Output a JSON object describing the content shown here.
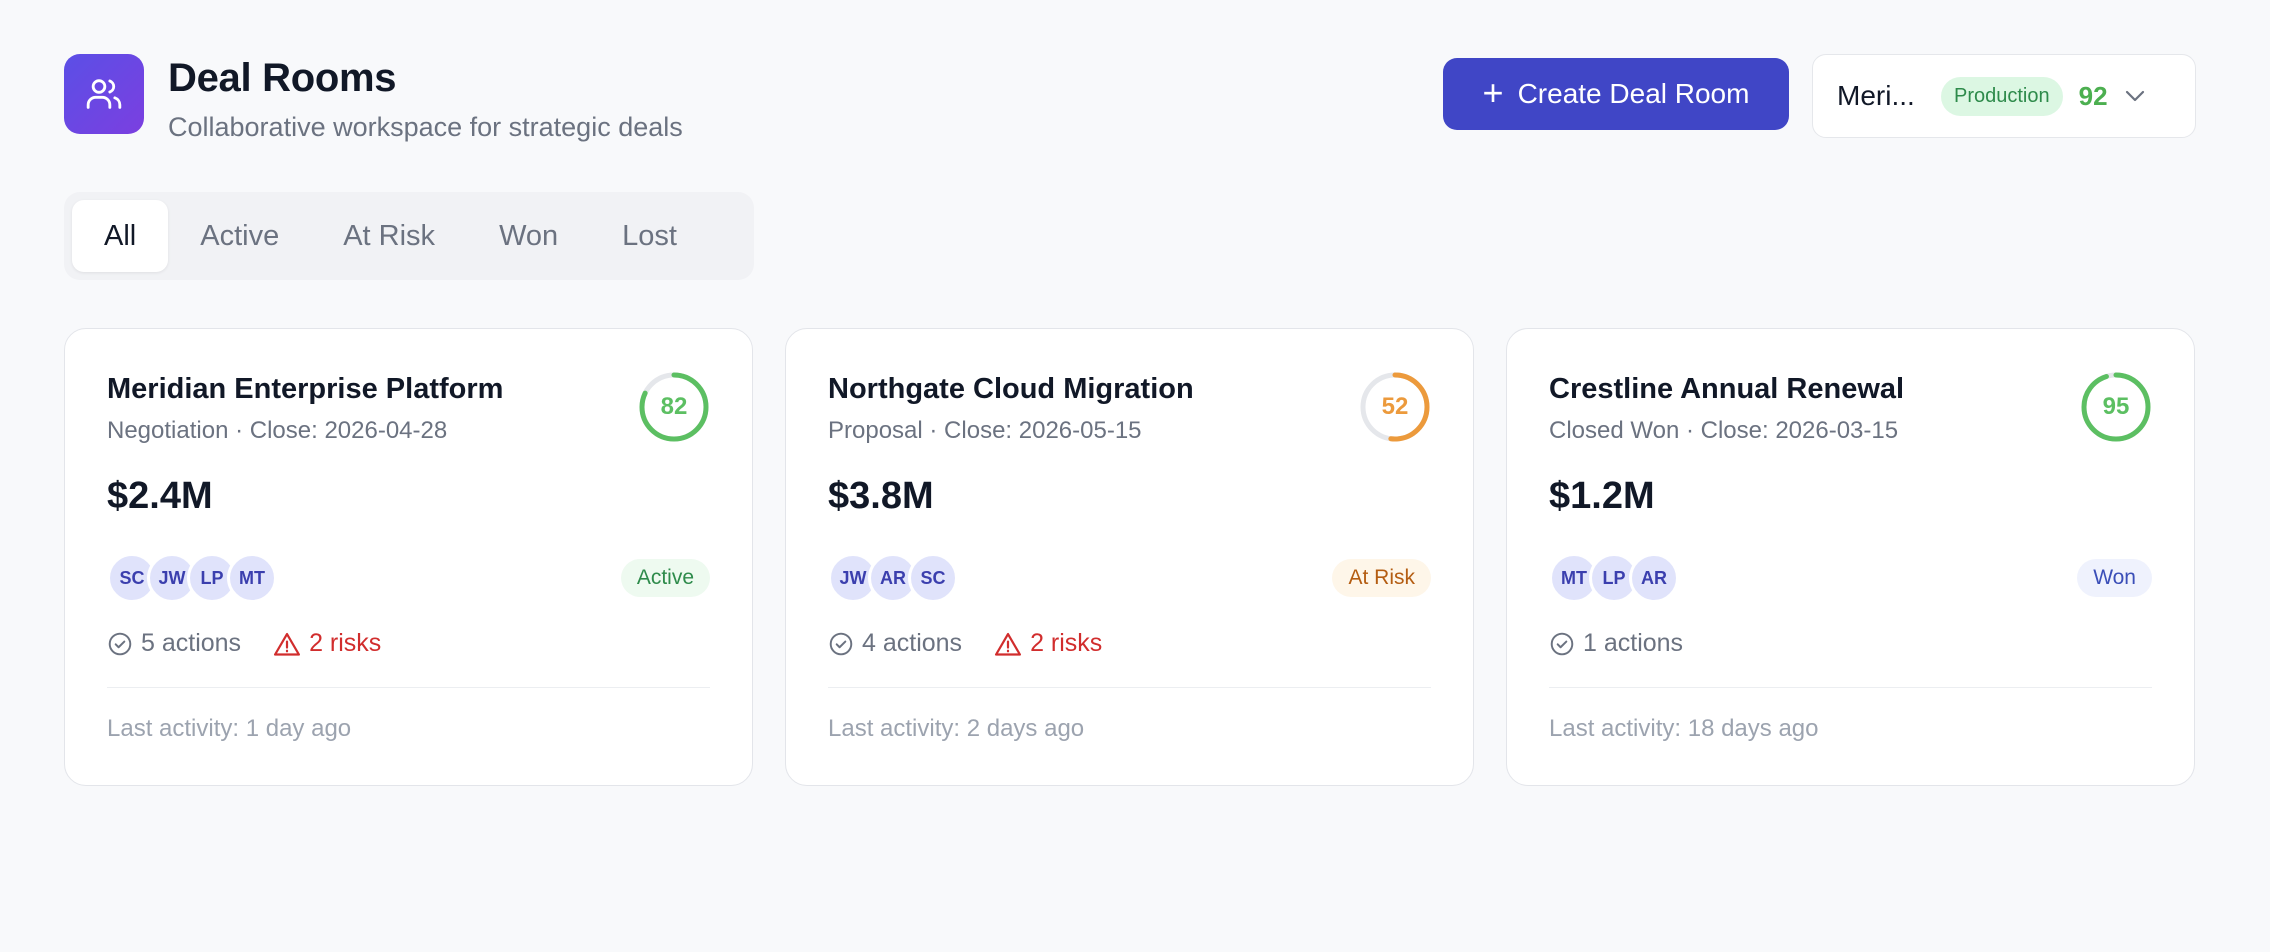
{
  "header": {
    "title": "Deal Rooms",
    "subtitle": "Collaborative workspace for strategic deals",
    "icon": "users-icon"
  },
  "create_button": {
    "label": "Create Deal Room"
  },
  "deal_selector": {
    "name": "Meri...",
    "environment": "Production",
    "score": "92"
  },
  "tabs": [
    {
      "label": "All",
      "active": true
    },
    {
      "label": "Active",
      "active": false
    },
    {
      "label": "At Risk",
      "active": false
    },
    {
      "label": "Won",
      "active": false
    },
    {
      "label": "Lost",
      "active": false
    }
  ],
  "cards": [
    {
      "title": "Meridian Enterprise Platform",
      "subtitle": "Negotiation · Close: 2026-04-28",
      "score": 82,
      "score_color": "#5cbf62",
      "amount": "$2.4M",
      "avatars": [
        "SC",
        "JW",
        "LP",
        "MT"
      ],
      "status": "Active",
      "status_bg": "#eefaf0",
      "status_color": "#2e8b4b",
      "actions": "5 actions",
      "risks": "2 risks",
      "last_activity": "Last activity: 1 day ago"
    },
    {
      "title": "Northgate Cloud Migration",
      "subtitle": "Proposal · Close: 2026-05-15",
      "score": 52,
      "score_color": "#ec9a3c",
      "amount": "$3.8M",
      "avatars": [
        "JW",
        "AR",
        "SC"
      ],
      "status": "At Risk",
      "status_bg": "#fef6e9",
      "status_color": "#b45d12",
      "actions": "4 actions",
      "risks": "2 risks",
      "last_activity": "Last activity: 2 days ago"
    },
    {
      "title": "Crestline Annual Renewal",
      "subtitle": "Closed Won · Close: 2026-03-15",
      "score": 95,
      "score_color": "#5cbf62",
      "amount": "$1.2M",
      "avatars": [
        "MT",
        "LP",
        "AR"
      ],
      "status": "Won",
      "status_bg": "#eff2fd",
      "status_color": "#3b4fb8",
      "actions": "1 actions",
      "risks": "",
      "last_activity": "Last activity: 18 days ago"
    }
  ]
}
